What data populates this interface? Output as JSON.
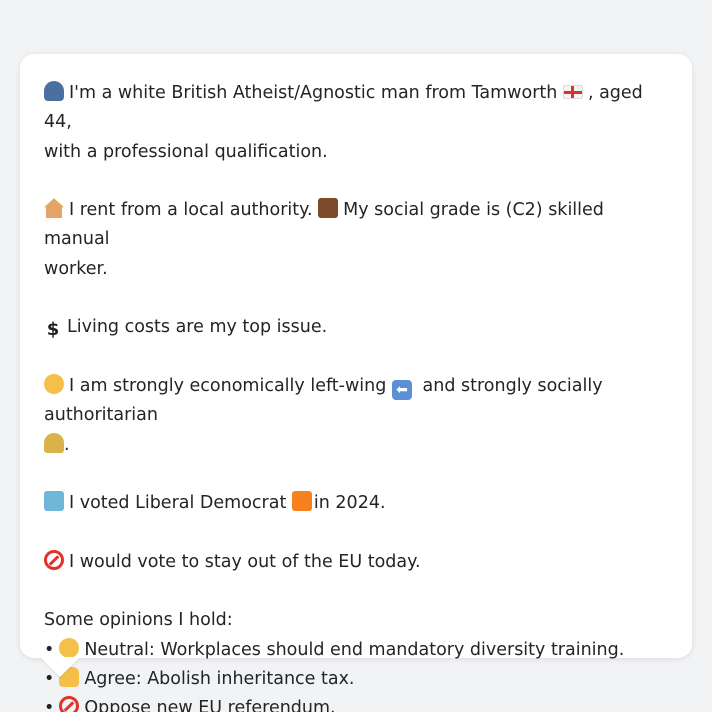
{
  "message": {
    "identity": {
      "text_a": "I'm a white British Atheist/Agnostic man from Tamworth",
      "text_b": ", aged 44,",
      "text_c": "with a professional qualification.",
      "icon": "user-icon",
      "flag_icon": "england-flag-icon"
    },
    "housing": {
      "text_a": "I rent from a local authority.",
      "text_b": "My social grade is (C2) skilled manual",
      "text_c": "worker.",
      "icons": [
        "house-icon",
        "briefcase-icon"
      ]
    },
    "issue": {
      "text": "Living costs are my top issue.",
      "icon": "dollar-icon",
      "glyph": "$"
    },
    "ideology": {
      "text_a": "I am strongly economically left-wing",
      "text_b": "and strongly socially authoritarian",
      "text_c": ".",
      "icons": [
        "thinking-icon",
        "left-arrow-icon",
        "lock-icon"
      ],
      "arrow_glyph": "⬅"
    },
    "vote": {
      "text_a": "I voted Liberal Democrat",
      "text_b": "in 2024.",
      "icons": [
        "ballot-box-icon",
        "orange-square-icon"
      ]
    },
    "eu": {
      "text": "I would vote to stay out of the EU today.",
      "icon": "no-entry-icon"
    },
    "opinions": {
      "heading": "Some opinions I hold:",
      "bullet": "•",
      "items": [
        {
          "text": "Neutral: Workplaces should end mandatory diversity training.",
          "icon": "neutral-face-icon"
        },
        {
          "text": "Agree: Abolish inheritance tax.",
          "icon": "thumbs-up-icon"
        },
        {
          "text": "Oppose new EU referendum.",
          "icon": "no-entry-icon"
        }
      ]
    }
  },
  "colors": {
    "background": "#f2f3f5",
    "bubble": "#ffffff",
    "text": "#222428",
    "accent_red": "#e0342a",
    "orange": "#f5821f"
  }
}
